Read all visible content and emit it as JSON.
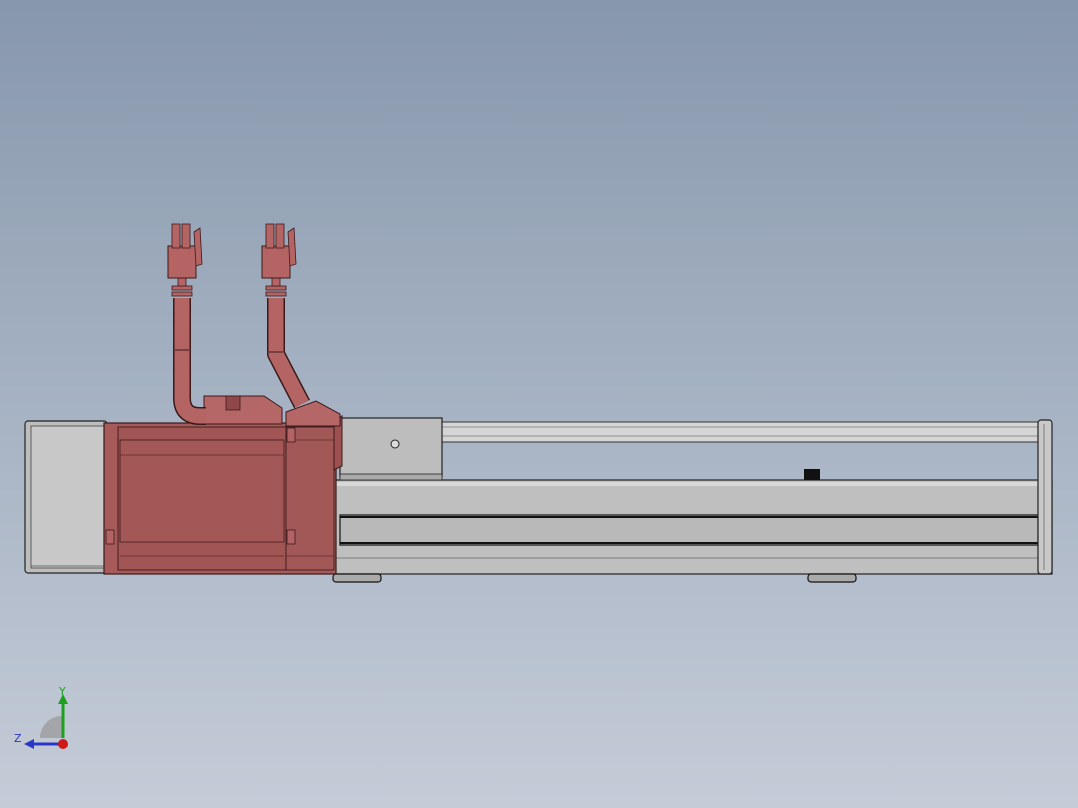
{
  "app": {
    "title": ""
  },
  "model": {
    "name": "",
    "motor_color": "#a65a5a",
    "frame_color": "#c9c9c9",
    "background_top": "#8797ac",
    "background_bottom": "#c5ccd8"
  },
  "triad": {
    "y_label": "Y",
    "z_label": "Z",
    "y_color": "#1ea01e",
    "z_color": "#2a36c8",
    "x_color": "#d01818"
  }
}
